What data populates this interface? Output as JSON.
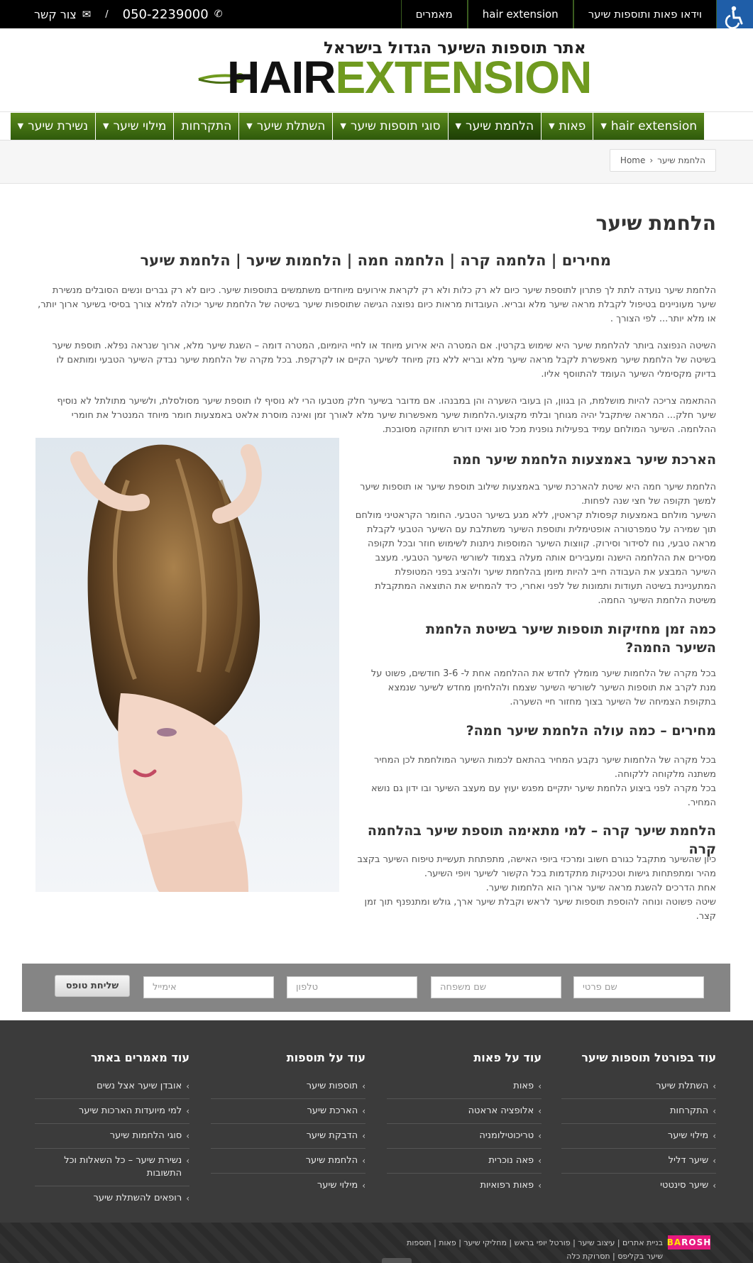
{
  "topbar": {
    "nav": [
      "וידאו פאות ותוספות שיער",
      "hair extension",
      "מאמרים"
    ],
    "phone": "050-2239000",
    "contact_label": "צור קשר",
    "separator": "/"
  },
  "logo": {
    "tagline": "אתר תוספות השיער הגדול בישראל",
    "word_dark": "HAIR",
    "word_green": "EXTENSION"
  },
  "menu": [
    {
      "label": "hair extension",
      "dropdown": true
    },
    {
      "label": "פאות",
      "dropdown": true
    },
    {
      "label": "הלחמת שיער",
      "dropdown": true,
      "active": true
    },
    {
      "label": "סוגי תוספות שיער",
      "dropdown": true
    },
    {
      "label": "השתלת שיער",
      "dropdown": true
    },
    {
      "label": "התקרחות",
      "dropdown": false
    },
    {
      "label": "מילוי שיער",
      "dropdown": true
    },
    {
      "label": "נשירת שיער",
      "dropdown": true
    }
  ],
  "breadcrumb": {
    "home": "Home",
    "current": "הלחמת שיער"
  },
  "page": {
    "title": "הלחמת שיער",
    "subtitle": "מחירים | הלחמה קרה | הלחמה חמה | הלחמות שיער  |  הלחמת שיער",
    "paragraphs": [
      "הלחמת שיער נועדה לתת לך פתרון לתוספת שיער כיום לא רק כלות ולא רק לקראת אירועים מיוחדים משתמשים בתוספות שיער. כיום לא רק גברים ונשים הסובלים מנשירת שיער מעוניינים בטיפול לקבלת מראה שיער מלא ובריא. העובדות מראות כיום נפוצה הגישה שתוספות שיער בשיטה של הלחמת שיער יכולה למלא צורך בסיסי בשיער ארוך יותר, או מלא יותר... לפי הצורך .",
      "השיטה הנפוצה ביותר להלחמת שיער היא שימוש בקרטין. אם המטרה היא אירוע מיוחד או לחיי היומיום, המטרה דומה – השגת שיער מלא, ארוך שנראה נפלא. תוספת שיער בשיטה של הלחמת שיער מאפשרת לקבל מראה שיער מלא ובריא ללא נזק מיוחד לשיער הקיים או לקרקפת. בכל מקרה של הלחמת שיער נבדק השיער הטבעי ומותאם לו בדיוק מקסימלי השיער העומד להתווסף אליו.",
      "ההתאמה צריכה להיות מושלמת, הן בגוון, הן בעובי השערה והן במבנהו. אם מדובר בשיער חלק מטבעו הרי לא נוסיף לו תוספת שיער מסולסלת, ולשיער מתולתל לא נוסיף שיער חלק... המראה שיתקבל יהיה מגוחך ובלתי מקצועי.הלחמות שיער מאפשרות שיער מלא לאורך זמן ואינה מוסרת אלאט באמצעות חומר מיוחד המנטרל את חומרי ההלחמה.  השיער המולחם עמיד בפעילות גופנית מכל סוג ואינו דורש תחזוקה מסובכת."
    ],
    "sections": [
      {
        "heading": "הארכת שיער באמצעות הלחמת שיער חמה",
        "lines": [
          "הלחמת שיער חמה היא שיטת להארכת שיער באמצעות שילוב תוספת שיער או תוספות שיער למשך תקופה של חצי שנה לפחות.",
          "השיער מולחם באמצעות קפסולת קראטין, ללא מגע בשיער הטבעי. החומר הקראטיני מולחם תוך שמירה על טמפרטורה אופטימלית ותוספת השיער משתלבת עם השיער הטבעי לקבלת מראה טבעי, נוח לסידור וסירוק. קווצות השיער המוספות ניתנות לשימוש חוזר ובכל תקופה מסירים את ההלחמה הישנה ומעבירים אותה מעלה בצמוד לשורשי השיער הטבעי. מעצב השיער המבצע את העבודה חייב להיות מיומן בהלחמת שיער ולהציג בפני המטופלת המתעניינת בשיטה תעודות ותמונות של לפני ואחרי, כיד להמחיש את התוצאה המתקבלת משיטת הלחמת השיער החמה."
        ]
      },
      {
        "heading": "כמה זמן מחזיקות תוספות שיער בשיטת הלחמת השיער החמה?",
        "lines": [
          "בכל מקרה של הלחמות שיער מומלץ לחדש את ההלחמה אחת ל- 3-6 חודשים, פשוט על מנת לקרב את תוספות השיער לשורשי השיער שצמח ולהלחימן מחדש לשיער שנמצא בתקופת הצמיחה של השיער בצוך מחזור חיי השערה."
        ]
      },
      {
        "heading": "מחירים – כמה עולה הלחמת שיער חמה?",
        "lines": [
          "בכל מקרה של הלחמות שיער נקבע המחיר בהתאם לכמות השיער המולחמת לכן המחיר משתנה מלקוחה ללקוחה.",
          "בכל מקרה לפני ביצוע הלחמת שיער יתקיים מפגש יעוץ עם מעצב השיער ובו ידון גם נושא המחיר."
        ]
      },
      {
        "heading": "הלחמת שיער קרה – למי מתאימה תוספת שיער בהלחמה קרה",
        "lines": [
          "כיון שהשיער מתקבל כגורם חשוב ומרכזי ביופי האישה, מתפתחת תעשיית טיפוח השיער בקצב מהיר ומתפתחות גישות וטכניקות מתקדמות בכל הקשור לשיער ויופי השיער.",
          "אחת הדרכים להשגת מראה שיער ארוך הוא הלחמות שיער.",
          "שיטה פשוטה ונוחה להוספת תוספות שיער לראש וקבלת שיער ארך, גולש ומתנפנף תוך זמן קצר."
        ]
      }
    ]
  },
  "form": {
    "first_name": "שם פרטי",
    "last_name": "שם משפחה",
    "phone": "טלפון",
    "email": "אימייל",
    "submit": "שליחת טופס"
  },
  "footer": {
    "columns": [
      {
        "title": "עוד בפורטל תוספות שיער",
        "items": [
          "השתלת שיער",
          "התקרחות",
          "מילוי שיער",
          "שיער דליל",
          "שיער סינטטי"
        ]
      },
      {
        "title": "עוד על פאות",
        "items": [
          "פאות",
          "אלופציה אראטה",
          "טריכוטילומניה",
          "פאה נוכרית",
          "פאות רפואיות"
        ]
      },
      {
        "title": "עוד על תוספות",
        "items": [
          "תוספות שיער",
          "הארכת שיער",
          "הדבקת שיער",
          "הלחמת שיער",
          "מילוי שיער"
        ]
      },
      {
        "title": "עוד מאמרים באתר",
        "items": [
          "אובדן שיער אצל נשים",
          "למי מיועדות הארכות שיער",
          "סוגי הלחמות שיער",
          "נשירת שיער – כל השאלות וכל התשובות",
          "רופאים להשתלת שיער"
        ]
      }
    ],
    "credits_line1": "בניית אתרים | עיצוב שיער | פורטל יופי בראש | מחליקי שיער | פאות | תוספות",
    "credits_line2": "שיער בקליפס | תסרוקת כלה",
    "brand_a": "BA",
    "brand_b": "ROSH"
  },
  "colors": {
    "menu_green": "#4d7c17",
    "logo_green": "#6f9a1f",
    "footer": "#3b3b3b",
    "form_band": "#858585"
  }
}
